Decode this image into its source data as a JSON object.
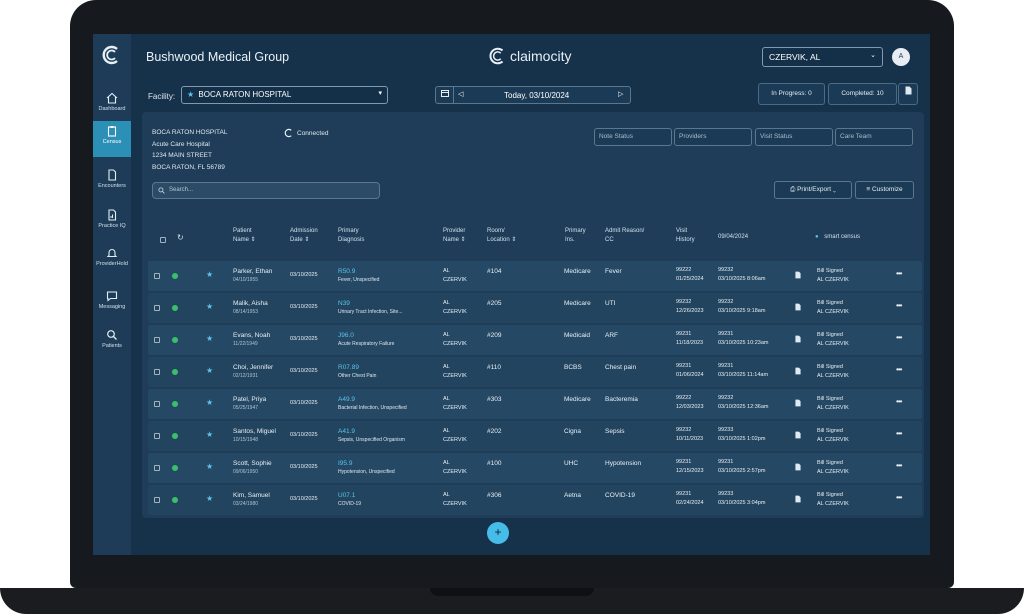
{
  "app": {
    "org_name": "Bushwood Medical Group",
    "brand": "claimocity",
    "user": "CZERVIK, AL",
    "avatar_initial": "A"
  },
  "nav": [
    {
      "label": "Dashboard"
    },
    {
      "label": "Census"
    },
    {
      "label": "Encounters"
    },
    {
      "label": "Practice IQ"
    },
    {
      "label": "ProviderHold"
    },
    {
      "label": "Messaging"
    },
    {
      "label": "Patients"
    }
  ],
  "toolbar": {
    "facility_label": "Facility:",
    "facility_value": "BOCA RATON HOSPITAL",
    "date_label": "Today, 03/10/2024",
    "in_progress": "In Progress: 0",
    "completed": "Completed: 10"
  },
  "facility_info": {
    "name": "BOCA RATON HOSPITAL",
    "type": "Acute Care Hospital",
    "street": "1234 MAIN STREET",
    "city": "BOCA RATON, FL 56789",
    "status": "Connected"
  },
  "filters": {
    "note_status": "Note Status",
    "providers": "Providers",
    "visit_status": "Visit Status",
    "care_team": "Care Team"
  },
  "search_placeholder": "Search...",
  "buttons": {
    "print_export": "Print/Export",
    "customize": "Customize",
    "add": "+"
  },
  "columns": {
    "patient": [
      "Patient",
      "Name ⇕"
    ],
    "admission": [
      "Admission",
      "Date ⇕"
    ],
    "diagnosis": [
      "Primary",
      "Diagnosis"
    ],
    "provider": [
      "Provider",
      "Name ⇕"
    ],
    "room": [
      "Room/",
      "Location ⇕"
    ],
    "ins": [
      "Primary",
      "Ins."
    ],
    "reason": [
      "Admit Reason/",
      "CC"
    ],
    "history": [
      "Visit",
      "History"
    ],
    "date": "09/04/2024",
    "smart": "smart census"
  },
  "rows": [
    {
      "name": "Parker, Ethan",
      "dob": "04/10/1955",
      "adm": "03/10/2025",
      "code": "R50.9",
      "diag": "Fever, Unspecified",
      "prov1": "AL",
      "prov2": "CZERVIK",
      "room": "#104",
      "ins": "Medicare",
      "reason": "Fever",
      "h1": "99222",
      "h2": "01/25/2024",
      "v1": "99232",
      "v2": "03/10/2025 8:06am",
      "s1": "Bill Signed",
      "s2": "AL CZERVIK"
    },
    {
      "name": "Malik, Aisha",
      "dob": "08/14/1953",
      "adm": "03/10/2025",
      "code": "N39",
      "diag": "Urinary Tract Infection, Site...",
      "prov1": "AL",
      "prov2": "CZERVIK",
      "room": "#205",
      "ins": "Medicare",
      "reason": "UTI",
      "h1": "99232",
      "h2": "12/26/2023",
      "v1": "99232",
      "v2": "03/10/2025 9:18am",
      "s1": "Bill Signed",
      "s2": "AL CZERVIK"
    },
    {
      "name": "Evans, Noah",
      "dob": "11/22/1949",
      "adm": "03/10/2025",
      "code": "J96.0",
      "diag": "Acute Respiratory Failure",
      "prov1": "AL",
      "prov2": "CZERVIK",
      "room": "#209",
      "ins": "Medicaid",
      "reason": "ARF",
      "h1": "99231",
      "h2": "11/18/2023",
      "v1": "99231",
      "v2": "03/10/2025 10:23am",
      "s1": "Bill Signed",
      "s2": "AL CZERVIK"
    },
    {
      "name": "Choi, Jennifer",
      "dob": "02/12/1931",
      "adm": "03/10/2025",
      "code": "R07.89",
      "diag": "Other Chest Pain",
      "prov1": "AL",
      "prov2": "CZERVIK",
      "room": "#110",
      "ins": "BCBS",
      "reason": "Chest pain",
      "h1": "99231",
      "h2": "01/06/2024",
      "v1": "99231",
      "v2": "03/10/2025 11:14am",
      "s1": "Bill Signed",
      "s2": "AL CZERVIK"
    },
    {
      "name": "Patel, Priya",
      "dob": "05/25/1947",
      "adm": "03/10/2025",
      "code": "A49.9",
      "diag": "Bacterial Infection, Unspecified",
      "prov1": "AL",
      "prov2": "CZERVIK",
      "room": "#303",
      "ins": "Medicare",
      "reason": "Bacteremia",
      "h1": "99222",
      "h2": "12/03/2023",
      "v1": "99232",
      "v2": "03/10/2025 12:36am",
      "s1": "Bill Signed",
      "s2": "AL CZERVIK"
    },
    {
      "name": "Santos, Miguel",
      "dob": "10/15/1948",
      "adm": "03/10/2025",
      "code": "A41.9",
      "diag": "Sepsis, Unspecified Organism",
      "prov1": "AL",
      "prov2": "CZERVIK",
      "room": "#202",
      "ins": "Cigna",
      "reason": "Sepsis",
      "h1": "99232",
      "h2": "10/11/2023",
      "v1": "99233",
      "v2": "03/10/2025 1:02pm",
      "s1": "Bill Signed",
      "s2": "AL CZERVIK"
    },
    {
      "name": "Scott, Sophie",
      "dob": "09/06/1950",
      "adm": "03/10/2025",
      "code": "I95.9",
      "diag": "Hypotension, Unspecified",
      "prov1": "AL",
      "prov2": "CZERVIK",
      "room": "#100",
      "ins": "UHC",
      "reason": "Hypotension",
      "h1": "99231",
      "h2": "12/15/2023",
      "v1": "99231",
      "v2": "03/10/2025 2:57pm",
      "s1": "Bill Signed",
      "s2": "AL CZERVIK"
    },
    {
      "name": "Kim, Samuel",
      "dob": "03/24/1980",
      "adm": "03/10/2025",
      "code": "U07.1",
      "diag": "COVID-19",
      "prov1": "AL",
      "prov2": "CZERVIK",
      "room": "#306",
      "ins": "Aetna",
      "reason": "COVID-19",
      "h1": "99231",
      "h2": "02/24/2024",
      "v1": "99233",
      "v2": "03/10/2025 3:04pm",
      "s1": "Bill Signed",
      "s2": "AL CZERVIK"
    }
  ]
}
